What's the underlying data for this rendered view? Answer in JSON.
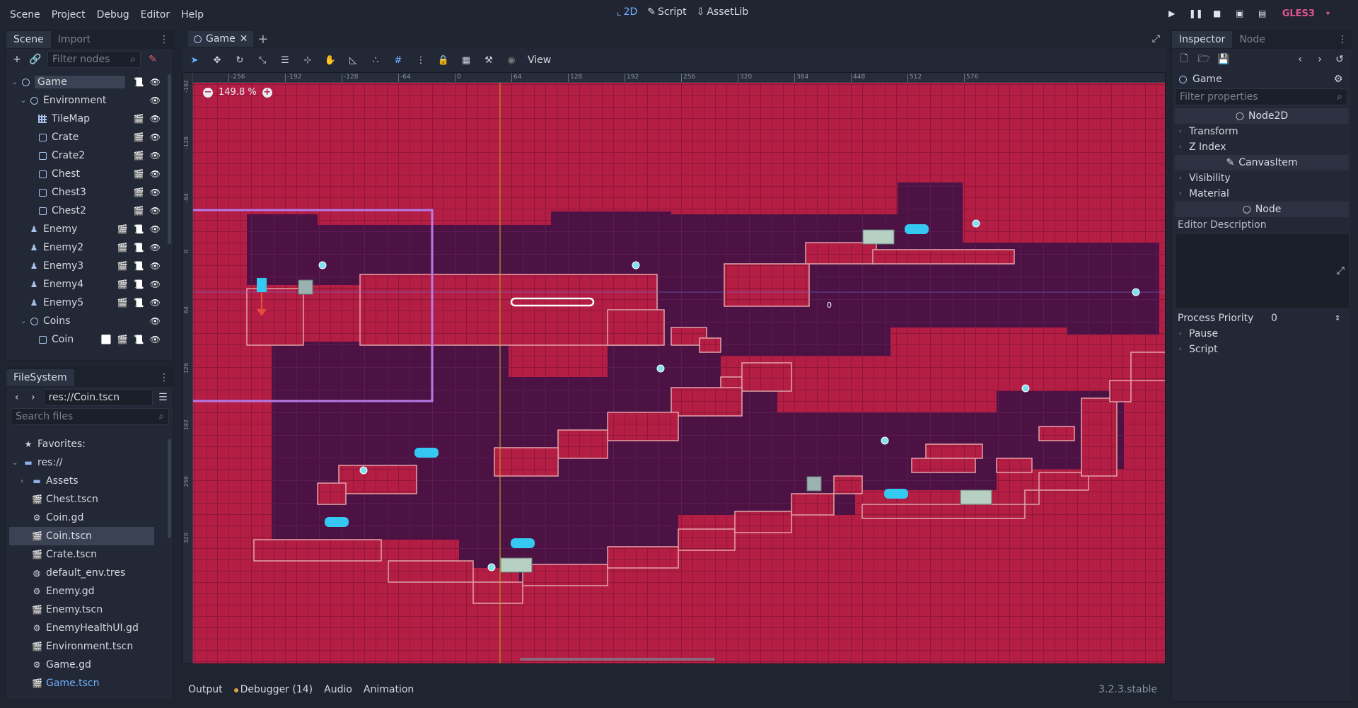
{
  "menu": [
    "Scene",
    "Project",
    "Debug",
    "Editor",
    "Help"
  ],
  "main_modes": [
    {
      "label": "2D",
      "icon": "2d-icon",
      "active": true
    },
    {
      "label": "Script",
      "icon": "script-icon",
      "active": false
    },
    {
      "label": "AssetLib",
      "icon": "assetlib-icon",
      "active": false
    }
  ],
  "renderer": "GLES3",
  "scene_panel": {
    "tabs": [
      "Scene",
      "Import"
    ],
    "filter_placeholder": "Filter nodes",
    "nodes": [
      {
        "label": "Game",
        "depth": 0,
        "type": "node2d",
        "arrow": "v",
        "selected": true,
        "icons": [
          "script",
          "eye"
        ]
      },
      {
        "label": "Environment",
        "depth": 1,
        "type": "node2d",
        "arrow": "v",
        "icons": [
          "eye"
        ]
      },
      {
        "label": "TileMap",
        "depth": 2,
        "type": "tilemap",
        "icons": [
          "clapper",
          "eye"
        ]
      },
      {
        "label": "Crate",
        "depth": 2,
        "type": "sprite",
        "icons": [
          "clapper",
          "eye"
        ]
      },
      {
        "label": "Crate2",
        "depth": 2,
        "type": "sprite",
        "icons": [
          "clapper",
          "eye"
        ]
      },
      {
        "label": "Chest",
        "depth": 2,
        "type": "sprite",
        "icons": [
          "clapper",
          "eye"
        ]
      },
      {
        "label": "Chest3",
        "depth": 2,
        "type": "sprite",
        "icons": [
          "clapper",
          "eye"
        ]
      },
      {
        "label": "Chest2",
        "depth": 2,
        "type": "sprite",
        "icons": [
          "clapper",
          "eye"
        ]
      },
      {
        "label": "Enemy",
        "depth": 1,
        "type": "body",
        "icons": [
          "clapper",
          "script",
          "eye"
        ]
      },
      {
        "label": "Enemy2",
        "depth": 1,
        "type": "body",
        "icons": [
          "clapper",
          "script",
          "eye"
        ]
      },
      {
        "label": "Enemy3",
        "depth": 1,
        "type": "body",
        "icons": [
          "clapper",
          "script",
          "eye"
        ]
      },
      {
        "label": "Enemy4",
        "depth": 1,
        "type": "body",
        "icons": [
          "clapper",
          "script",
          "eye"
        ]
      },
      {
        "label": "Enemy5",
        "depth": 1,
        "type": "body",
        "icons": [
          "clapper",
          "script",
          "eye"
        ]
      },
      {
        "label": "Coins",
        "depth": 1,
        "type": "node2d",
        "arrow": "v",
        "icons": [
          "eye"
        ]
      },
      {
        "label": "Coin",
        "depth": 2,
        "type": "area",
        "icons": [
          "signal",
          "clapper",
          "script",
          "eye"
        ]
      }
    ]
  },
  "filesystem": {
    "tab": "FileSystem",
    "path": "res://Coin.tscn",
    "search_placeholder": "Search files",
    "items": [
      {
        "label": "Favorites:",
        "depth": 0,
        "icon": "star-icon"
      },
      {
        "label": "res://",
        "depth": 0,
        "icon": "folder-icon",
        "arrow": "v"
      },
      {
        "label": "Assets",
        "depth": 1,
        "icon": "folder-icon",
        "arrow": ">"
      },
      {
        "label": "Chest.tscn",
        "depth": 1,
        "icon": "scene-icon"
      },
      {
        "label": "Coin.gd",
        "depth": 1,
        "icon": "gear-icon"
      },
      {
        "label": "Coin.tscn",
        "depth": 1,
        "icon": "scene-icon",
        "selected": true
      },
      {
        "label": "Crate.tscn",
        "depth": 1,
        "icon": "scene-icon"
      },
      {
        "label": "default_env.tres",
        "depth": 1,
        "icon": "globe-icon"
      },
      {
        "label": "Enemy.gd",
        "depth": 1,
        "icon": "gear-icon"
      },
      {
        "label": "Enemy.tscn",
        "depth": 1,
        "icon": "scene-icon"
      },
      {
        "label": "EnemyHealthUI.gd",
        "depth": 1,
        "icon": "gear-icon"
      },
      {
        "label": "Environment.tscn",
        "depth": 1,
        "icon": "scene-icon"
      },
      {
        "label": "Game.gd",
        "depth": 1,
        "icon": "gear-icon"
      },
      {
        "label": "Game.tscn",
        "depth": 1,
        "icon": "scene-icon",
        "highlight": true
      }
    ]
  },
  "viewport": {
    "tab_label": "Game",
    "view_menu": "View",
    "zoom_label": "149.8 %",
    "ruler_ticks": [
      "-256",
      "-192",
      "-128",
      "-64",
      "0",
      "64",
      "128",
      "192",
      "256",
      "320",
      "384",
      "448",
      "512",
      "576"
    ],
    "ruler_v_ticks": [
      "-192",
      "-128",
      "-64",
      "0",
      "64",
      "128",
      "192",
      "256",
      "320"
    ],
    "marker_text": "0"
  },
  "bottom": {
    "tabs": [
      "Output",
      "Debugger (14)",
      "Audio",
      "Animation"
    ],
    "version": "3.2.3.stable"
  },
  "inspector": {
    "tabs": [
      "Inspector",
      "Node"
    ],
    "node_name": "Game",
    "filter_placeholder": "Filter properties",
    "categories": [
      {
        "type": "category",
        "label": "Node2D"
      },
      {
        "type": "section",
        "label": "Transform"
      },
      {
        "type": "section",
        "label": "Z Index"
      },
      {
        "type": "category",
        "label": "CanvasItem"
      },
      {
        "type": "section",
        "label": "Visibility"
      },
      {
        "type": "section",
        "label": "Material"
      },
      {
        "type": "category",
        "label": "Node"
      }
    ],
    "editor_description_label": "Editor Description",
    "process_priority_label": "Process Priority",
    "process_priority_value": "0",
    "bottom_sections": [
      "Pause",
      "Script"
    ]
  },
  "colors": {
    "accent": "#6fb0ff",
    "tile_red": "#b41e45",
    "cave_purple": "#4a1242",
    "renderer": "#e0568d"
  }
}
